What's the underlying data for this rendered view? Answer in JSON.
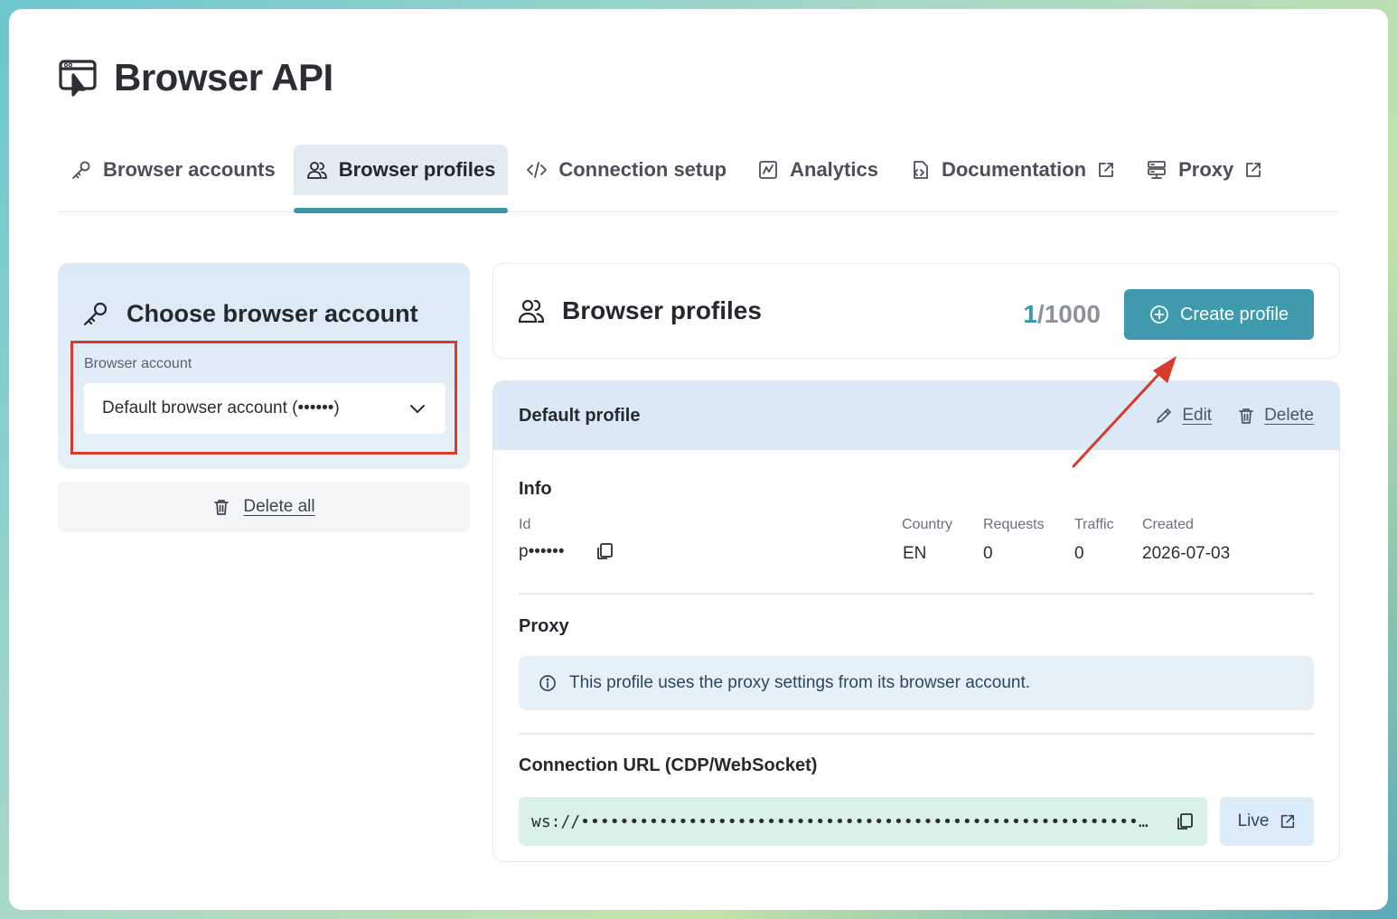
{
  "app": {
    "title": "Browser API",
    "logo_icon": "browser-cursor-icon"
  },
  "tabs": [
    {
      "label": "Browser accounts",
      "icon": "key-icon",
      "active": false,
      "external": false
    },
    {
      "label": "Browser profiles",
      "icon": "users-icon",
      "active": true,
      "external": false
    },
    {
      "label": "Connection setup",
      "icon": "code-icon",
      "active": false,
      "external": false
    },
    {
      "label": "Analytics",
      "icon": "chart-icon",
      "active": false,
      "external": false
    },
    {
      "label": "Documentation",
      "icon": "docs-icon",
      "active": false,
      "external": true
    },
    {
      "label": "Proxy",
      "icon": "server-icon",
      "active": false,
      "external": true
    }
  ],
  "account_panel": {
    "title": "Choose browser account",
    "field_label": "Browser account",
    "selected_account": "Default browser account (••••••)",
    "delete_all_label": "Delete all"
  },
  "profiles_panel": {
    "title": "Browser profiles",
    "count_used": "1",
    "count_total": "/1000",
    "create_label": "Create profile"
  },
  "profile": {
    "name": "Default profile",
    "edit_label": "Edit",
    "delete_label": "Delete",
    "info_title": "Info",
    "id_label": "Id",
    "id_value": "p••••••",
    "country_label": "Country",
    "country_value": "EN",
    "requests_label": "Requests",
    "requests_value": "0",
    "traffic_label": "Traffic",
    "traffic_value": "0",
    "created_label": "Created",
    "created_value": "2026-07-03",
    "proxy_title": "Proxy",
    "proxy_note": "This profile uses the proxy settings from its browser account.",
    "connection_title": "Connection URL (CDP/WebSocket)",
    "connection_url": "ws://•••••••••••••••••••••••••••••••••••••••••••••••••••••••••…",
    "live_label": "Live"
  },
  "colors": {
    "accent": "#3f9aae",
    "highlight_box": "#d63b2b",
    "panel_blue": "#dbe9f7",
    "url_bg": "#daf1ea"
  }
}
